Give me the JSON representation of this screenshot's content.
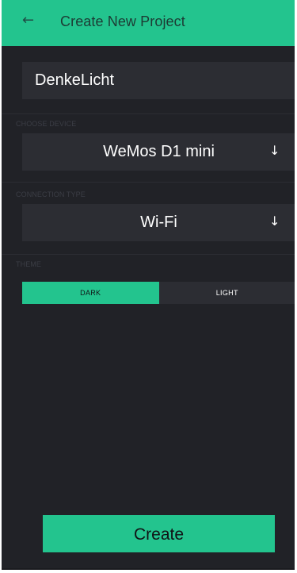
{
  "header": {
    "back_icon": "arrow-left-icon",
    "title": "Create New Project"
  },
  "project": {
    "name": "DenkeLicht"
  },
  "device": {
    "label": "CHOOSE DEVICE",
    "value": "WeMos D1 mini",
    "arrow_icon": "arrow-down-icon"
  },
  "connection": {
    "label": "CONNECTION TYPE",
    "value": "Wi-Fi",
    "arrow_icon": "arrow-down-icon"
  },
  "theme": {
    "label": "THEME",
    "options": [
      {
        "label": "DARK",
        "selected": true
      },
      {
        "label": "LIGHT",
        "selected": false
      }
    ]
  },
  "actions": {
    "create_label": "Create"
  },
  "colors": {
    "accent": "#23c48e",
    "background": "#212227",
    "surface": "#2c2d33",
    "muted_text": "#3b3d45"
  }
}
